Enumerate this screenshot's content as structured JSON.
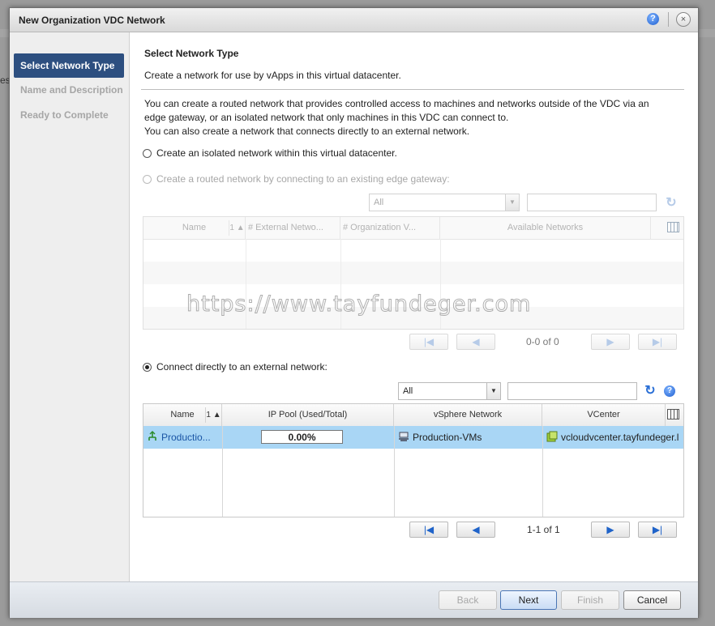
{
  "background": {
    "edge_text": "es"
  },
  "dialog": {
    "title": "New Organization VDC Network",
    "help_glyph": "?",
    "close_glyph": "×"
  },
  "steps": [
    {
      "label": "Select Network Type",
      "active": true
    },
    {
      "label": "Name and Description",
      "active": false
    },
    {
      "label": "Ready to Complete",
      "active": false
    }
  ],
  "content": {
    "heading": "Select Network Type",
    "subheading": "Create a network for use by vApps in this virtual datacenter.",
    "description_lines": [
      "You can create a routed network that provides controlled access to machines and networks outside of the VDC via an",
      "edge gateway, or an isolated network that only machines in this VDC can connect to.",
      "You can also create a network that connects directly to an external network."
    ],
    "options": {
      "isolated": "Create an isolated network within this virtual datacenter.",
      "routed": "Create a routed network by connecting to an existing edge gateway:",
      "direct": "Connect directly to an external network:"
    },
    "selected_option": "direct"
  },
  "edge_grid": {
    "filter_value": "All",
    "search_value": "",
    "columns": [
      "Name",
      "# External Netwo...",
      "# Organization V...",
      "Available Networks"
    ],
    "sort_indicator": "1 ▲",
    "pager_text": "0-0 of 0"
  },
  "external_grid": {
    "filter_value": "All",
    "search_value": "",
    "columns": [
      "Name",
      "IP Pool (Used/Total)",
      "vSphere Network",
      "VCenter"
    ],
    "sort_indicator": "1 ▲",
    "rows": [
      {
        "name": "Productio...",
        "ip_pool": "0.00%",
        "vsphere_network": "Production-VMs",
        "vcenter": "vcloudvcenter.tayfundeger.l"
      }
    ],
    "pager_text": "1-1 of 1"
  },
  "footer": {
    "back": "Back",
    "next": "Next",
    "finish": "Finish",
    "cancel": "Cancel"
  },
  "watermark": "https://www.tayfundeger.com",
  "colors": {
    "active_step": "#2d4f80",
    "selected_row": "#a9d6f5",
    "link": "#1a55a5",
    "accent_blue": "#2a6fd6"
  }
}
